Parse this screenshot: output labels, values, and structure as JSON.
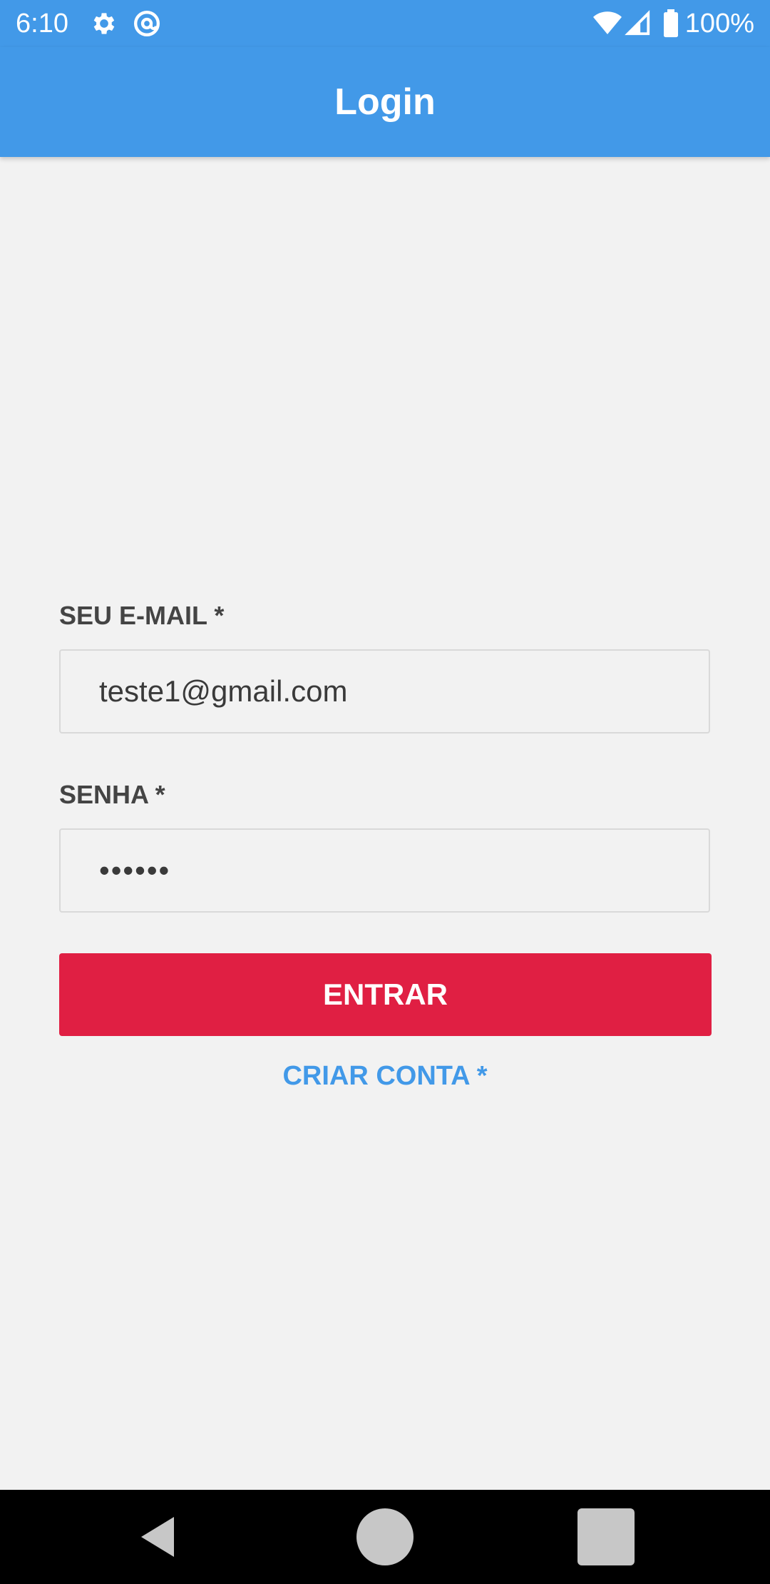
{
  "status_bar": {
    "time": "6:10",
    "battery": "100%",
    "background": "#4299e8",
    "icons": [
      "settings-icon",
      "at-sign-icon",
      "wifi-icon",
      "signal-icon",
      "battery-icon"
    ]
  },
  "app_bar": {
    "title": "Login",
    "background": "#4299e8"
  },
  "form": {
    "email_label": "SEU E-MAIL *",
    "email_value": "teste1@gmail.com",
    "password_label": "SENHA *",
    "password_value": "••••••",
    "submit_label": "ENTRAR",
    "submit_color": "#e01f43",
    "create_account_label": "CRIAR CONTA *",
    "link_color": "#4299e8"
  },
  "nav_bar": {
    "buttons": [
      "back-icon",
      "home-icon",
      "recents-icon"
    ]
  }
}
